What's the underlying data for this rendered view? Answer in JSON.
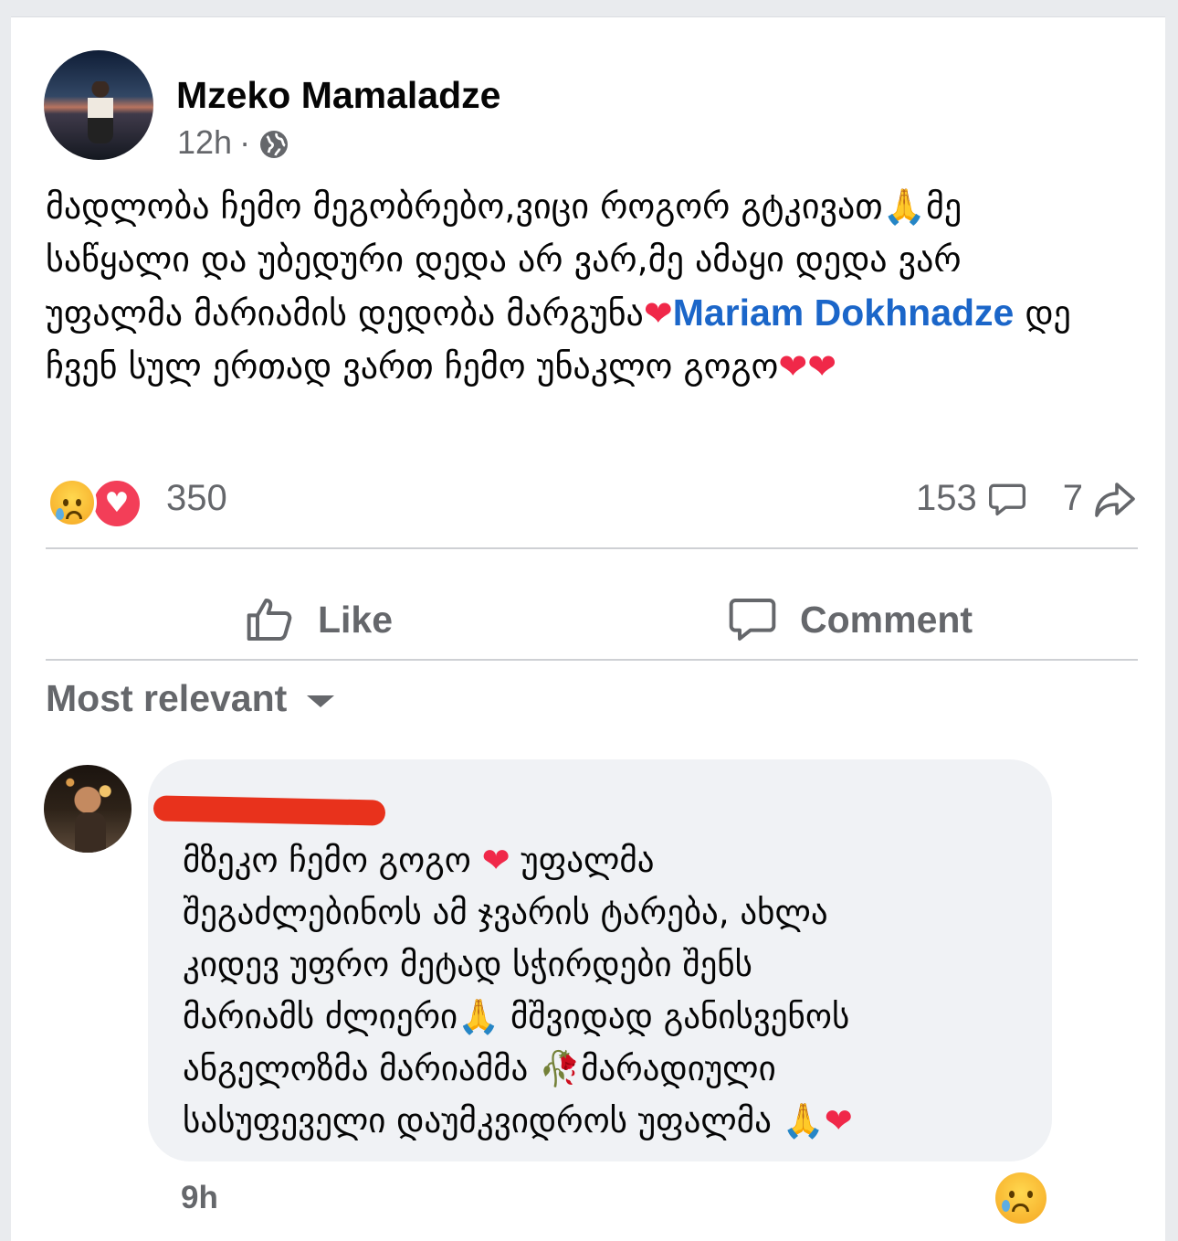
{
  "post": {
    "author": "Mzeko Mamaladze",
    "timestamp": "12h",
    "separator": "·",
    "privacy_icon": "globe-icon",
    "text_line1": "მადლობა ჩემო მეგობრებო,ვიცი როგორ გტკივათ",
    "text_line1_emoji": "🙏",
    "text_line1_tail": "მე",
    "text_line2": "საწყალი და უბედური დედა არ ვარ,მე ამაყი დედა ვარ",
    "text_line3": "უფალმა მარიამის დედობა მარგუნა",
    "text_line3_emoji": "❤",
    "mention": "Mariam Dokhnadze",
    "text_after_mention": " დე ჩვენ სულ ერთად ვართ ჩემო უნაკლო გოგო",
    "text_end_emoji": "❤❤"
  },
  "stats": {
    "reaction_icons": [
      "sad-icon",
      "love-icon"
    ],
    "reaction_count": "350",
    "comment_count": "153",
    "share_count": "7"
  },
  "actions": {
    "like_label": "Like",
    "comment_label": "Comment"
  },
  "sort": {
    "label": "Most relevant"
  },
  "comment": {
    "author_redacted": true,
    "line1": "მზეკო ჩემო გოგო ",
    "line1_emoji": "❤",
    "line1_tail": " უფალმა",
    "line2": "შეგაძლებინოს ამ ჯვარის ტარება, ახლა",
    "line3": "კიდევ უფრო მეტად სჭირდები შენს",
    "line4": "მარიამს ძლიერი",
    "line4_emoji": "🙏",
    "line4_tail": " მშვიდად განისვენოს",
    "line5": "ანგელოზმა მარიამმა ",
    "line5_emoji": "🥀",
    "line5_tail": "მარადიული",
    "line6": "სასუფეველი დაუმკვიდროს უფალმა ",
    "line6_emoji": "🙏",
    "line6_emoji2": "❤",
    "time": "9h",
    "reaction_icon": "sad-icon"
  },
  "colors": {
    "mention": "#1b66c9",
    "secondary_text": "#65676b",
    "love": "#f33e58",
    "redaction": "#e8321c",
    "bubble": "#f0f2f5"
  }
}
